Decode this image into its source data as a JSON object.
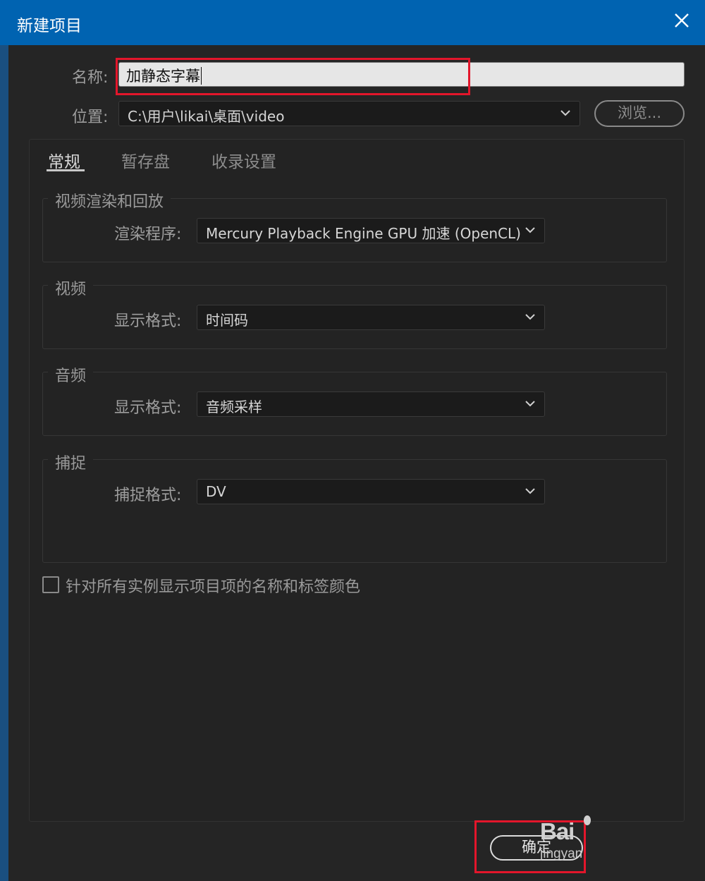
{
  "window": {
    "title": "新建项目",
    "close_icon": "close-icon"
  },
  "form": {
    "name_label": "名称:",
    "name_value": "加静态字幕",
    "location_label": "位置:",
    "location_value": "C:\\用户\\likai\\桌面\\video",
    "browse_label": "浏览..."
  },
  "tabs": [
    {
      "label": "常规",
      "active": true
    },
    {
      "label": "暂存盘",
      "active": false
    },
    {
      "label": "收录设置",
      "active": false
    }
  ],
  "groups": {
    "render": {
      "title": "视频渲染和回放",
      "field_label": "渲染程序:",
      "value": "Mercury Playback Engine GPU 加速 (OpenCL)"
    },
    "video": {
      "title": "视频",
      "field_label": "显示格式:",
      "value": "时间码"
    },
    "audio": {
      "title": "音频",
      "field_label": "显示格式:",
      "value": "音频采样"
    },
    "capture": {
      "title": "捕捉",
      "field_label": "捕捉格式:",
      "value": "DV"
    }
  },
  "checkbox": {
    "label": "针对所有实例显示项目项的名称和标签颜色",
    "checked": false
  },
  "footer": {
    "ok_label": "确定"
  },
  "watermark": {
    "brand": "Bai",
    "sub": "jingyan"
  },
  "colors": {
    "titlebar": "#0063b1",
    "highlight": "#e3162b",
    "background": "#252525"
  }
}
